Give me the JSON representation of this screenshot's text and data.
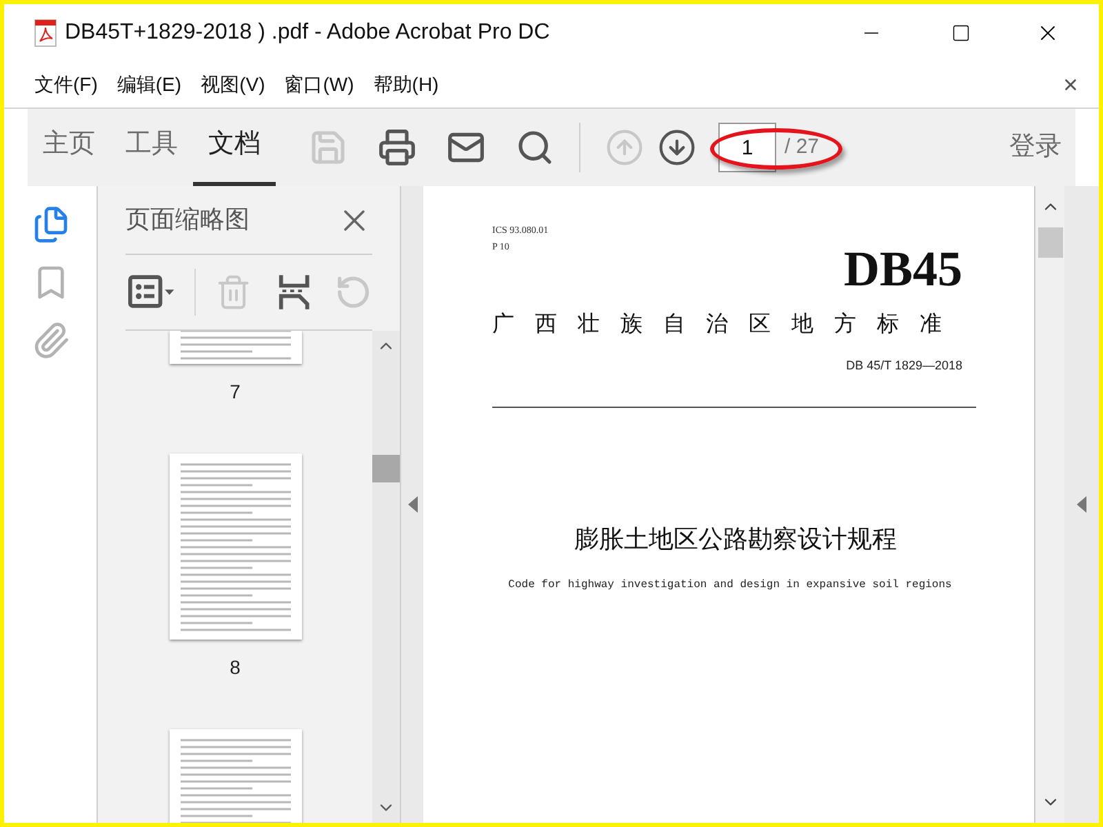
{
  "window": {
    "title": "DB45T+1829-2018 ) .pdf - Adobe Acrobat Pro DC"
  },
  "menu": [
    "文件(F)",
    "编辑(E)",
    "视图(V)",
    "窗口(W)",
    "帮助(H)"
  ],
  "tabs": [
    {
      "label": "主页",
      "selected": false
    },
    {
      "label": "工具",
      "selected": false
    },
    {
      "label": "文档",
      "selected": true
    }
  ],
  "toolbar": {
    "tools": [
      {
        "kind": "save",
        "disabled": true
      },
      {
        "kind": "print",
        "disabled": false
      },
      {
        "kind": "mail",
        "disabled": false
      },
      {
        "kind": "search",
        "disabled": false
      }
    ],
    "nav": [
      {
        "kind": "up",
        "disabled": true
      },
      {
        "kind": "down",
        "disabled": false
      }
    ],
    "page_field": {
      "value": "1",
      "total": "/ 27",
      "circled": true
    },
    "sign_in": "登录"
  },
  "rail": [
    {
      "kind": "pages",
      "selected": true
    },
    {
      "kind": "bookmarks",
      "selected": false
    },
    {
      "kind": "attachments",
      "selected": false
    }
  ],
  "thumbnail_panel": {
    "title": "页面缩略图",
    "tools": [
      {
        "kind": "options",
        "disabled": false
      },
      {
        "kind": "delete",
        "disabled": true
      },
      {
        "kind": "extract",
        "disabled": false
      },
      {
        "kind": "rotate",
        "disabled": true
      }
    ],
    "thumbnails": [
      {
        "kind": "cut_top",
        "label": "7"
      },
      {
        "kind": "full",
        "label": "8"
      },
      {
        "kind": "cut_bottom"
      }
    ]
  },
  "document": {
    "ics": "ICS 93.080.01",
    "class": "P 10",
    "code": "DB45",
    "issuer": "广西壮族自治区地方标准",
    "number": "DB 45/T 1829—2018",
    "title_cn": "膨胀土地区公路勘察设计规程",
    "title_en": "Code for highway investigation and design in expansive soil regions"
  }
}
